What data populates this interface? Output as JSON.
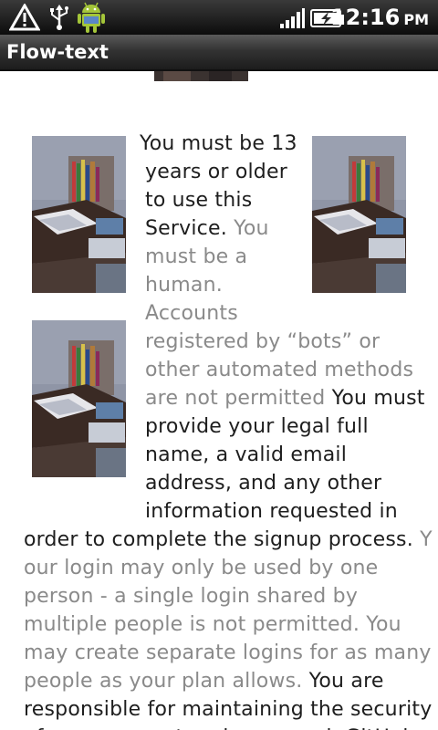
{
  "status_bar": {
    "time": "12:16",
    "ampm": "PM",
    "icons": [
      "alert-triangle-icon",
      "usb-icon",
      "android-debug-icon",
      "signal-icon",
      "battery-charging-icon"
    ]
  },
  "title_bar": {
    "title": "Flow-text"
  },
  "content": {
    "lines": [
      [
        {
          "t": "You must be 13",
          "c": "dark"
        }
      ],
      [
        {
          "t": "years or older",
          "c": "dark"
        }
      ],
      [
        {
          "t": "to use this",
          "c": "dark"
        }
      ],
      [
        {
          "t": "Service. ",
          "c": "dark"
        },
        {
          "t": "You",
          "c": "light"
        }
      ],
      [
        {
          "t": "must be a",
          "c": "light"
        }
      ],
      [
        {
          "t": "human.",
          "c": "light"
        }
      ],
      [
        {
          "t": "Accounts",
          "c": "light"
        }
      ],
      [
        {
          "t": "registered by “bots” or",
          "c": "light"
        }
      ],
      [
        {
          "t": "other automated methods",
          "c": "light"
        }
      ],
      [
        {
          "t": "are not permitted ",
          "c": "light"
        },
        {
          "t": "You must",
          "c": "dark"
        }
      ],
      [
        {
          "t": "provide your legal full",
          "c": "dark"
        }
      ],
      [
        {
          "t": "name, a valid email",
          "c": "dark"
        }
      ],
      [
        {
          "t": "address, and any other",
          "c": "dark"
        }
      ],
      [
        {
          "t": "information requested in",
          "c": "dark"
        }
      ],
      [
        {
          "t": "order to complete the signup process. ",
          "c": "dark"
        },
        {
          "t": "Y",
          "c": "light"
        }
      ],
      [
        {
          "t": "our login may only be used by one",
          "c": "light"
        }
      ],
      [
        {
          "t": "person - a single login shared by",
          "c": "light"
        }
      ],
      [
        {
          "t": "multiple people is not permitted. You",
          "c": "light"
        }
      ],
      [
        {
          "t": "may create separate logins for as many",
          "c": "light"
        }
      ],
      [
        {
          "t": "people as your plan allows. ",
          "c": "light"
        },
        {
          "t": "You are",
          "c": "dark"
        }
      ],
      [
        {
          "t": "responsible for maintaining the security",
          "c": "dark"
        }
      ],
      [
        {
          "t": "of your account and password. GitHub",
          "c": "dark"
        }
      ]
    ]
  }
}
